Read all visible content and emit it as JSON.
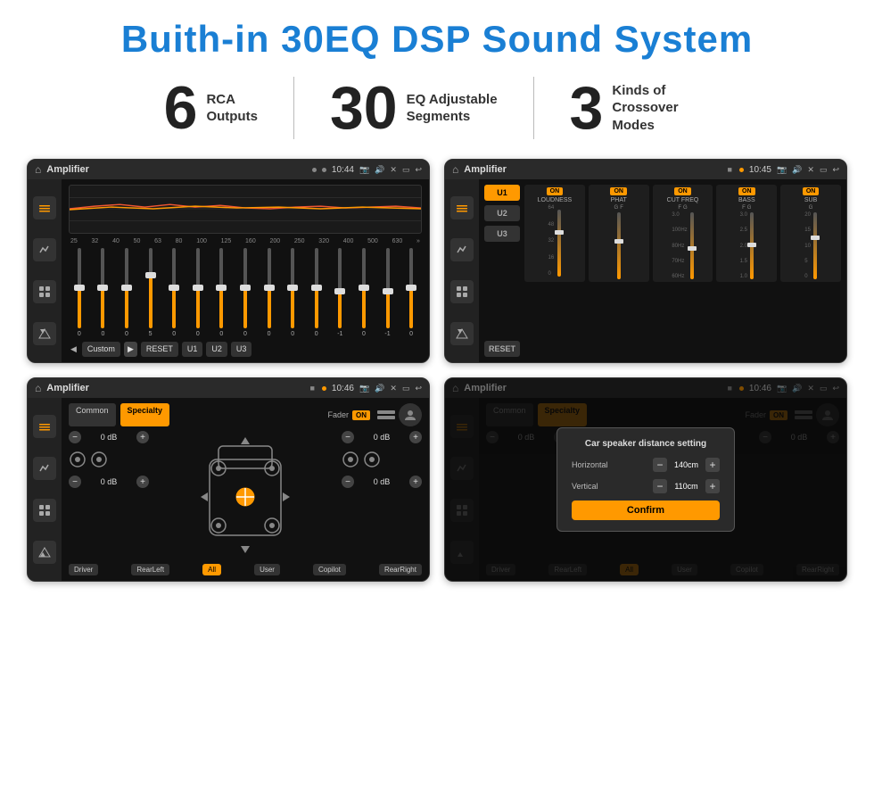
{
  "header": {
    "title": "Buith-in 30EQ DSP Sound System"
  },
  "stats": [
    {
      "number": "6",
      "desc_line1": "RCA",
      "desc_line2": "Outputs"
    },
    {
      "number": "30",
      "desc_line1": "EQ Adjustable",
      "desc_line2": "Segments"
    },
    {
      "number": "3",
      "desc_line1": "Kinds of",
      "desc_line2": "Crossover Modes"
    }
  ],
  "screens": [
    {
      "id": "eq-screen",
      "status_bar": {
        "app": "Amplifier",
        "time": "10:44",
        "dots": "● ▶"
      },
      "eq_labels": [
        "25",
        "32",
        "40",
        "50",
        "63",
        "80",
        "100",
        "125",
        "160",
        "200",
        "250",
        "320",
        "400",
        "500",
        "630"
      ],
      "eq_values": [
        "0",
        "0",
        "0",
        "5",
        "0",
        "0",
        "0",
        "0",
        "0",
        "0",
        "0",
        "-1",
        "0",
        "-1"
      ],
      "bottom_buttons": [
        "◀",
        "Custom",
        "▶",
        "RESET",
        "U1",
        "U2",
        "U3"
      ]
    },
    {
      "id": "crossover-screen",
      "status_bar": {
        "app": "Amplifier",
        "time": "10:45",
        "dots": "■ ●"
      },
      "presets": [
        "U1",
        "U2",
        "U3"
      ],
      "channels": [
        "LOUDNESS",
        "PHAT",
        "CUT FREQ",
        "BASS",
        "SUB"
      ],
      "on_labels": [
        "ON",
        "ON",
        "ON",
        "ON",
        "ON"
      ]
    },
    {
      "id": "fader-screen",
      "status_bar": {
        "app": "Amplifier",
        "time": "10:46",
        "dots": "■ ●"
      },
      "tabs": [
        "Common",
        "Specialty"
      ],
      "fader_label": "Fader",
      "fader_on": "ON",
      "db_values": [
        "0 dB",
        "0 dB",
        "0 dB",
        "0 dB"
      ],
      "bottom_buttons": [
        "Driver",
        "RearLeft",
        "All",
        "User",
        "Copilot",
        "RearRight"
      ]
    },
    {
      "id": "dialog-screen",
      "status_bar": {
        "app": "Amplifier",
        "time": "10:46",
        "dots": "■ ●"
      },
      "tabs": [
        "Common",
        "Specialty"
      ],
      "dialog": {
        "title": "Car speaker distance setting",
        "horizontal_label": "Horizontal",
        "horizontal_value": "140cm",
        "vertical_label": "Vertical",
        "vertical_value": "110cm",
        "confirm_label": "Confirm"
      },
      "db_values": [
        "0 dB",
        "0 dB"
      ],
      "bottom_buttons": [
        "Driver",
        "RearLeft",
        "All",
        "User",
        "Copilot",
        "RearRight"
      ]
    }
  ]
}
